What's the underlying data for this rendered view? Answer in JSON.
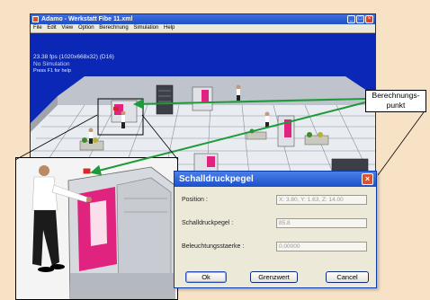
{
  "window": {
    "title": "Adamo - Werkstatt Fibe 11.xml",
    "menu": [
      "File",
      "Edit",
      "View",
      "Option",
      "Berechnung",
      "Simulation",
      "Help"
    ],
    "minimize_glyph": "_",
    "maximize_glyph": "□",
    "close_glyph": "×"
  },
  "hud": {
    "fps": "23.38 fps (1020x668x32) (D16)",
    "simulation": "No Simulation",
    "help": "Press F1 for help"
  },
  "callout": {
    "line1": "Berechnungs-",
    "line2": "punkt"
  },
  "dialog": {
    "title": "Schalldruckpegel",
    "close_glyph": "×",
    "fields": [
      {
        "label": "Position :",
        "value": "X: 3.80, Y: 1.63, Z: 14.00"
      },
      {
        "label": "Schalldruckpegel :",
        "value": "85.8"
      },
      {
        "label": "Beleuchtungsstaerke :",
        "value": "0.00000"
      }
    ],
    "buttons": {
      "ok": "Ok",
      "grenzwert": "Grenzwert",
      "cancel": "Cancel"
    }
  },
  "colors": {
    "background": "#f7e2c6",
    "viewport_blue": "#0b27b5",
    "arrow_green": "#1e9a3a",
    "machine_magenta": "#e0237f",
    "titlebar_blue": "#1b51c9"
  }
}
